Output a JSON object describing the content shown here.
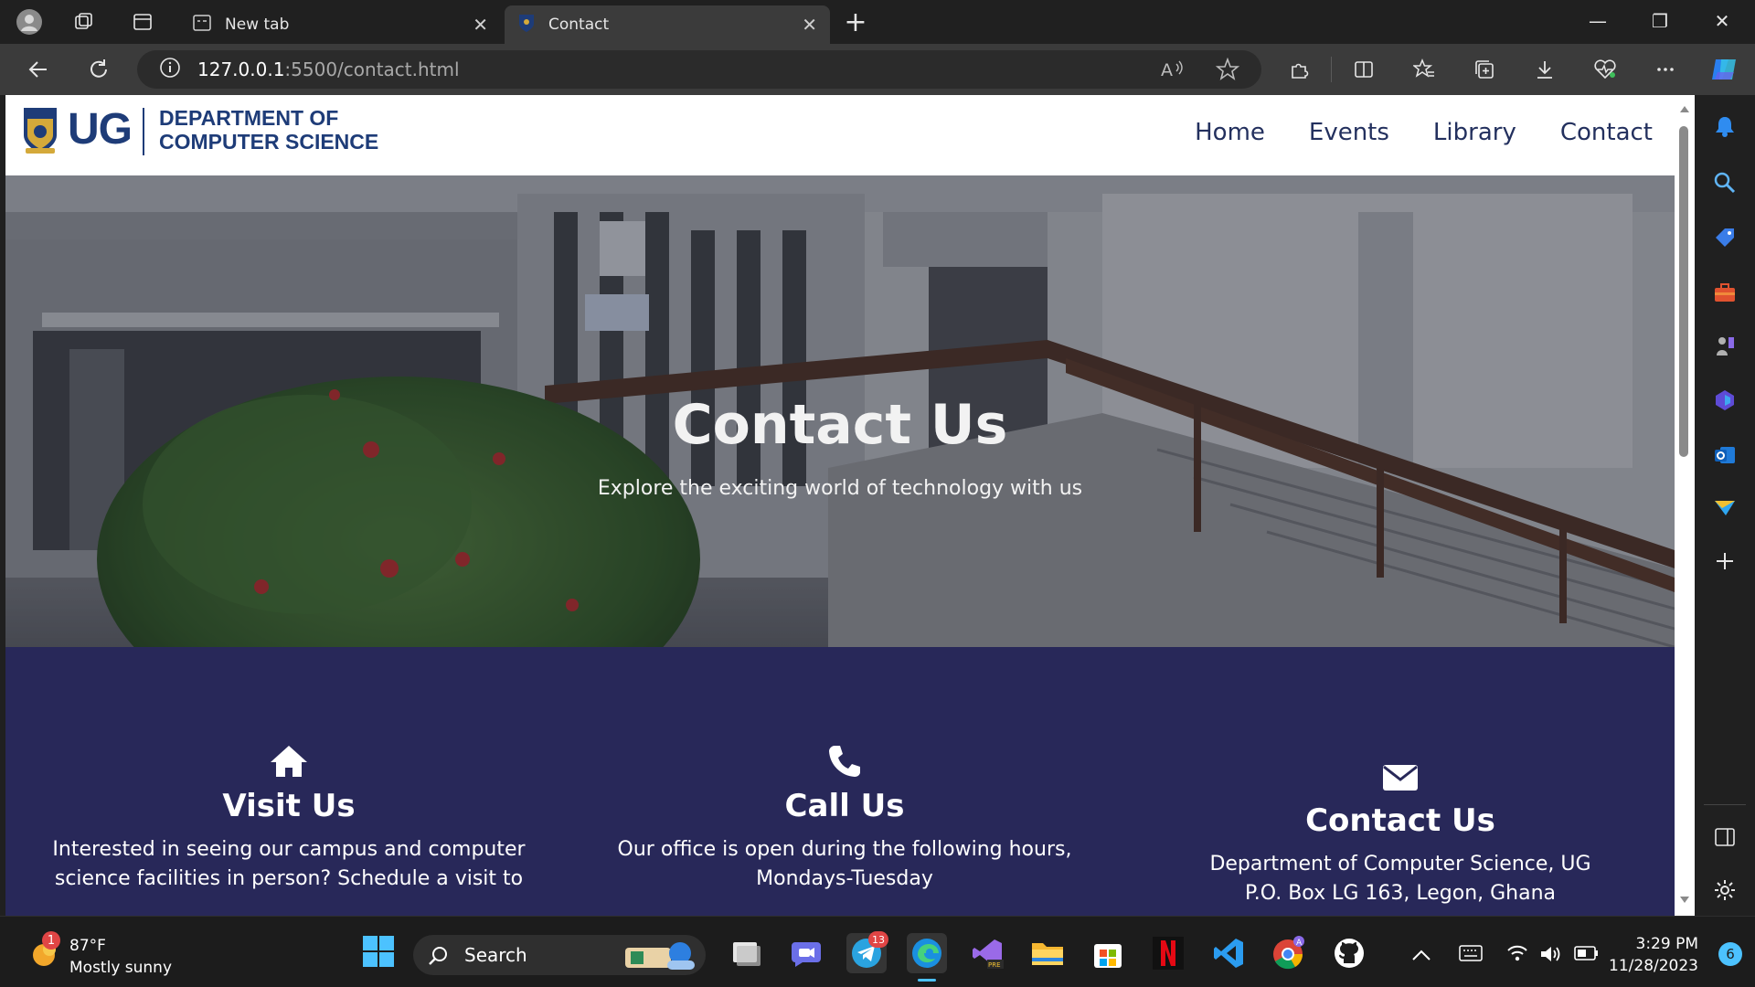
{
  "browser": {
    "tabs": [
      {
        "label": "New tab",
        "close": "✕"
      },
      {
        "label": "Contact",
        "close": "✕"
      }
    ],
    "new_tab": "+",
    "window_controls": {
      "minimize": "—",
      "restore": "❐",
      "close": "✕"
    },
    "address": {
      "host": "127.0.0.1",
      "rest": ":5500/contact.html"
    }
  },
  "site": {
    "logo_mark": "UG",
    "logo_line1": "DEPARTMENT OF",
    "logo_line2": "COMPUTER SCIENCE",
    "nav": [
      "Home",
      "Events",
      "Library",
      "Contact"
    ],
    "hero_title": "Contact Us",
    "hero_subtitle": "Explore the exciting world of technology with us",
    "cards": [
      {
        "icon": "home-icon",
        "title": "Visit Us",
        "text_lines": [
          "Interested in seeing our campus and computer",
          "science facilities in person? Schedule a visit to"
        ]
      },
      {
        "icon": "phone-icon",
        "title": "Call Us",
        "text_lines": [
          "Our office is open during the following hours,",
          "Mondays-Tuesday"
        ]
      },
      {
        "icon": "envelope-icon",
        "title": "Contact Us",
        "text_lines": [
          "Department of Computer Science, UG",
          "P.O. Box LG 163, Legon, Ghana"
        ]
      }
    ],
    "colors": {
      "brand_blue": "#1e3c78",
      "nav_text": "#23305e",
      "info_bg": "#282859"
    }
  },
  "taskbar": {
    "weather_badge": "1",
    "weather_temp": "87°F",
    "weather_desc": "Mostly sunny",
    "search_label": "Search",
    "telegram_badge": "13",
    "clock_time": "3:29 PM",
    "clock_date": "11/28/2023",
    "notification_count": "6"
  }
}
